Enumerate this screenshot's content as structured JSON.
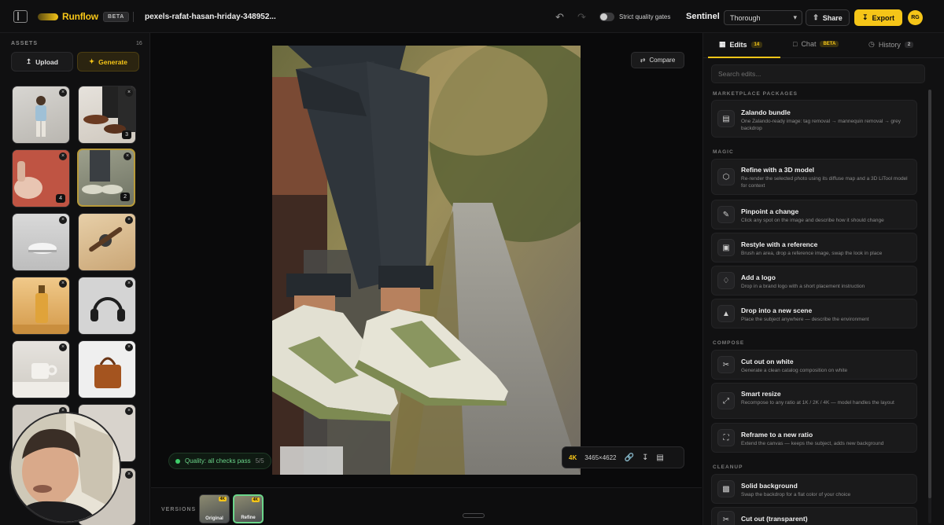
{
  "header": {
    "logo_text": "Runflow",
    "beta": "BETA",
    "file_name": "pexels-rafat-hasan-hriday-348952...",
    "toggle_label": "Strict quality gates",
    "sentinel_label": "Sentinel",
    "sentinel_mode": "Thorough",
    "share_label": "Share",
    "export_label": "Export",
    "avatar_initials": "RG"
  },
  "assets": {
    "title": "ASSETS",
    "count": "16",
    "upload_label": "Upload",
    "generate_label": "Generate",
    "thumb_counts": {
      "t2": "3",
      "t3": "4",
      "t4": "2"
    }
  },
  "canvas": {
    "compare_label": "Compare",
    "quality_text": "Quality: all checks pass",
    "quality_ratio": "5/5",
    "resolution": "4K",
    "dimensions": "3465×4622"
  },
  "versions": {
    "label": "VERSIONS",
    "items": [
      {
        "label": "Original",
        "badge": "4K"
      },
      {
        "label": "Refine",
        "badge": "4K"
      }
    ]
  },
  "right_panel": {
    "tabs": [
      {
        "label": "Edits",
        "badge": "14"
      },
      {
        "label": "Chat",
        "badge": "BETA"
      },
      {
        "label": "History",
        "badge": "2"
      }
    ],
    "search_placeholder": "Search edits...",
    "sections": {
      "marketplace": "MARKETPLACE PACKAGES",
      "magic": "MAGIC",
      "compose": "COMPOSE",
      "cleanup": "CLEANUP"
    },
    "cards": {
      "zalando": {
        "title": "Zalando bundle",
        "desc": "One Zalando-ready image: tag removal → mannequin removal → grey backdrop"
      },
      "refine3d": {
        "title": "Refine with a 3D model",
        "desc": "Re-render the selected photo using its diffuse map and a 3D LiTool model for context"
      },
      "pinpoint": {
        "title": "Pinpoint a change",
        "desc": "Click any spot on the image and describe how it should change"
      },
      "restyle": {
        "title": "Restyle with a reference",
        "desc": "Brush an area, drop a reference image, swap the look in place"
      },
      "logo": {
        "title": "Add a logo",
        "desc": "Drop in a brand logo with a short placement instruction"
      },
      "scene": {
        "title": "Drop into a new scene",
        "desc": "Place the subject anywhere — describe the environment"
      },
      "cutwhite": {
        "title": "Cut out on white",
        "desc": "Generate a clean catalog composition on white"
      },
      "smartresize": {
        "title": "Smart resize",
        "desc": "Recompose to any ratio at 1K / 2K / 4K — model handles the layout"
      },
      "reframe": {
        "title": "Reframe to a new ratio",
        "desc": "Extend the canvas — keeps the subject, adds new background"
      },
      "solidbg": {
        "title": "Solid background",
        "desc": "Swap the backdrop for a flat color of your choice"
      },
      "cutout": {
        "title": "Cut out (transparent)",
        "desc": ""
      }
    }
  },
  "colors": {
    "accent": "#f5c518",
    "success": "#3ecf6a",
    "bg": "#0b0b0c"
  }
}
